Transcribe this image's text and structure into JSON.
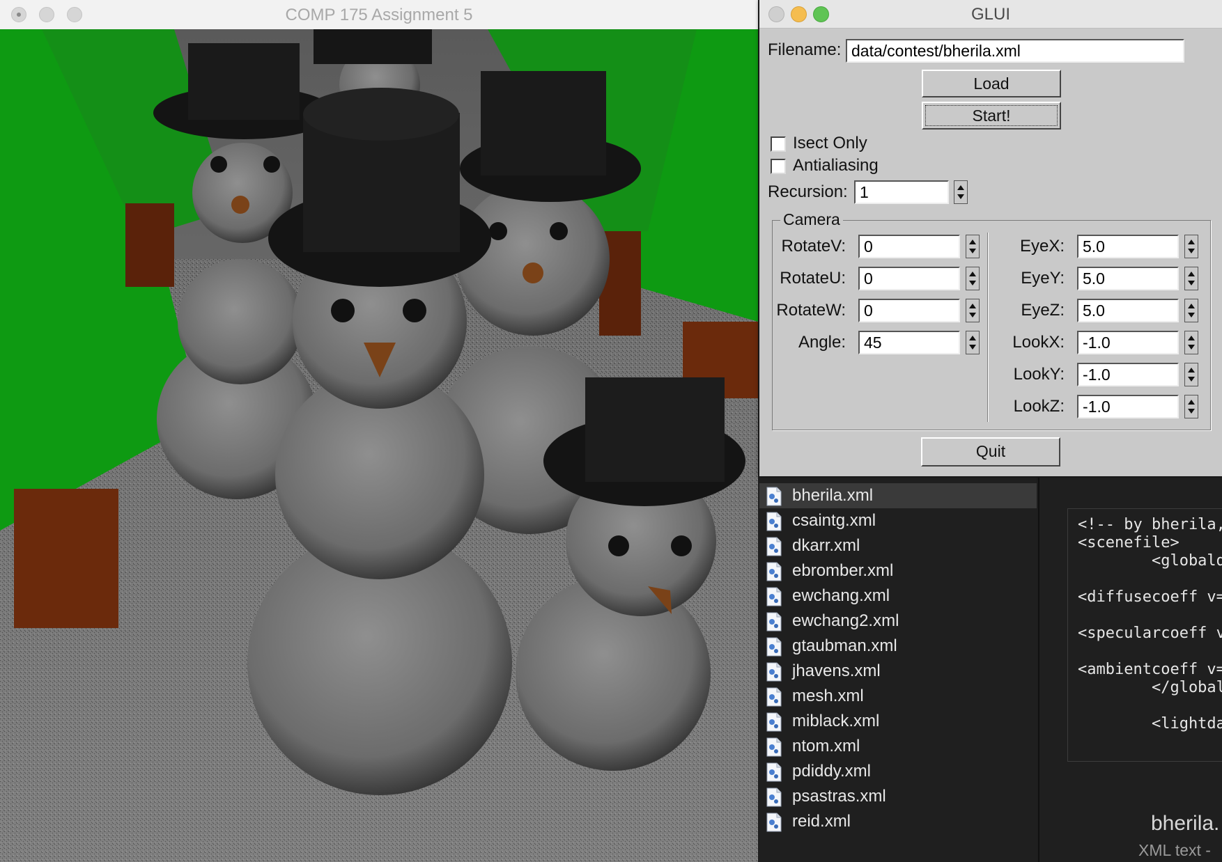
{
  "render_window": {
    "title": "COMP 175 Assignment 5",
    "scene": {
      "description_icon": "raytraced-snowmen-scene"
    }
  },
  "glui": {
    "title": "GLUI",
    "filename_label": "Filename:",
    "filename_value": "data/contest/bherila.xml",
    "load_label": "Load",
    "start_label": "Start!",
    "isect_only_label": "Isect Only",
    "isect_only_checked": false,
    "antialiasing_label": "Antialiasing",
    "antialiasing_checked": false,
    "recursion_label": "Recursion:",
    "recursion_value": "1",
    "camera": {
      "legend": "Camera",
      "rotate_v": {
        "label": "RotateV:",
        "value": "0"
      },
      "rotate_u": {
        "label": "RotateU:",
        "value": "0"
      },
      "rotate_w": {
        "label": "RotateW:",
        "value": "0"
      },
      "angle": {
        "label": "Angle:",
        "value": "45"
      },
      "eye_x": {
        "label": "EyeX:",
        "value": "5.0"
      },
      "eye_y": {
        "label": "EyeY:",
        "value": "5.0"
      },
      "eye_z": {
        "label": "EyeZ:",
        "value": "5.0"
      },
      "look_x": {
        "label": "LookX:",
        "value": "-1.0"
      },
      "look_y": {
        "label": "LookY:",
        "value": "-1.0"
      },
      "look_z": {
        "label": "LookZ:",
        "value": "-1.0"
      }
    },
    "quit_label": "Quit",
    "colors": {
      "close": "#c9c9c9",
      "minimize": "#f5bd4f",
      "zoom": "#5fc454"
    }
  },
  "file_list": {
    "icon": "xml-file-icon",
    "selected": "bherila.xml",
    "files": [
      "bherila.xml",
      "csaintg.xml",
      "dkarr.xml",
      "ebromber.xml",
      "ewchang.xml",
      "ewchang2.xml",
      "gtaubman.xml",
      "jhavens.xml",
      "mesh.xml",
      "miblack.xml",
      "ntom.xml",
      "pdiddy.xml",
      "psastras.xml",
      "reid.xml"
    ]
  },
  "preview": {
    "code_lines": [
      "<!-- by bherila,",
      "<scenefile>",
      "        <globalda",
      "",
      "<diffusecoeff v=",
      "",
      "<specularcoeff v",
      "",
      "<ambientcoeff v=",
      "        </globalda",
      "",
      "        <lightdat"
    ],
    "file_name": "bherila.",
    "file_kind": "XML text -"
  }
}
